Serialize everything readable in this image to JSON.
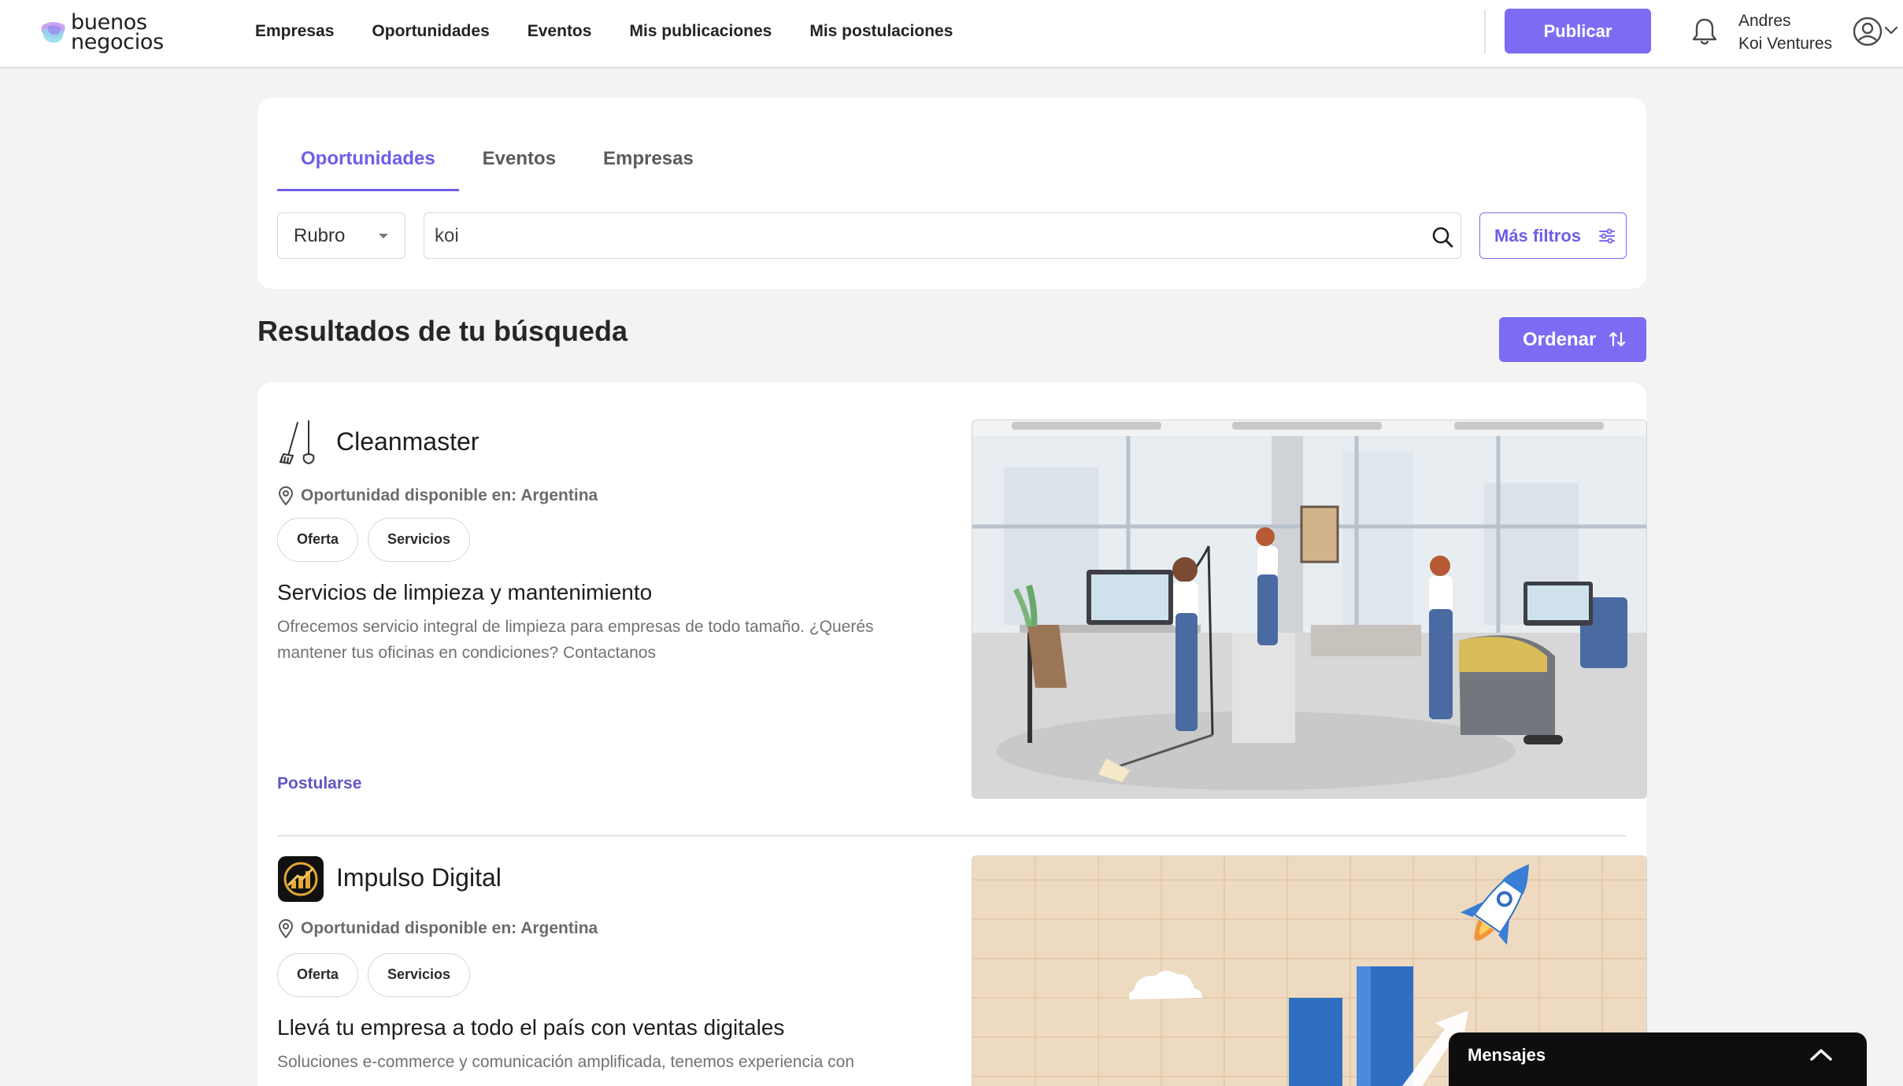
{
  "header": {
    "logo_line1": "buenos",
    "logo_line2": "negocios",
    "nav": [
      "Empresas",
      "Oportunidades",
      "Eventos",
      "Mis publicaciones",
      "Mis postulaciones"
    ],
    "publish_label": "Publicar",
    "user_name": "Andres",
    "user_company": "Koi Ventures",
    "icons": {
      "notifications": "bell-icon",
      "account": "user-circle-icon",
      "account_menu": "chevron-down-icon"
    }
  },
  "search": {
    "tabs": [
      "Oportunidades",
      "Eventos",
      "Empresas"
    ],
    "active_tab": "Oportunidades",
    "rubro_label": "Rubro",
    "query": "koi",
    "more_filters_label": "Más filtros"
  },
  "results": {
    "title": "Resultados de tu búsqueda",
    "sort_label": "Ordenar",
    "items": [
      {
        "company": "Cleanmaster",
        "location": "Oportunidad disponible en: Argentina",
        "tags": [
          "Oferta",
          "Servicios"
        ],
        "title": "Servicios de limpieza y mantenimiento",
        "description": "Ofrecemos servicio integral de limpieza para empresas de todo tamaño. ¿Querés mantener tus oficinas en condiciones? Contactanos",
        "action": "Postularse"
      },
      {
        "company": "Impulso Digital",
        "location": "Oportunidad disponible en: Argentina",
        "tags": [
          "Oferta",
          "Servicios"
        ],
        "title": "Llevá tu empresa a todo el país con ventas digitales",
        "description": "Soluciones e-commerce y comunicación amplificada, tenemos experiencia con"
      }
    ]
  },
  "messages": {
    "label": "Mensajes"
  },
  "colors": {
    "accent": "#7b6cf3",
    "accent_text": "#6d5ee8",
    "background": "#f3f3f3"
  }
}
